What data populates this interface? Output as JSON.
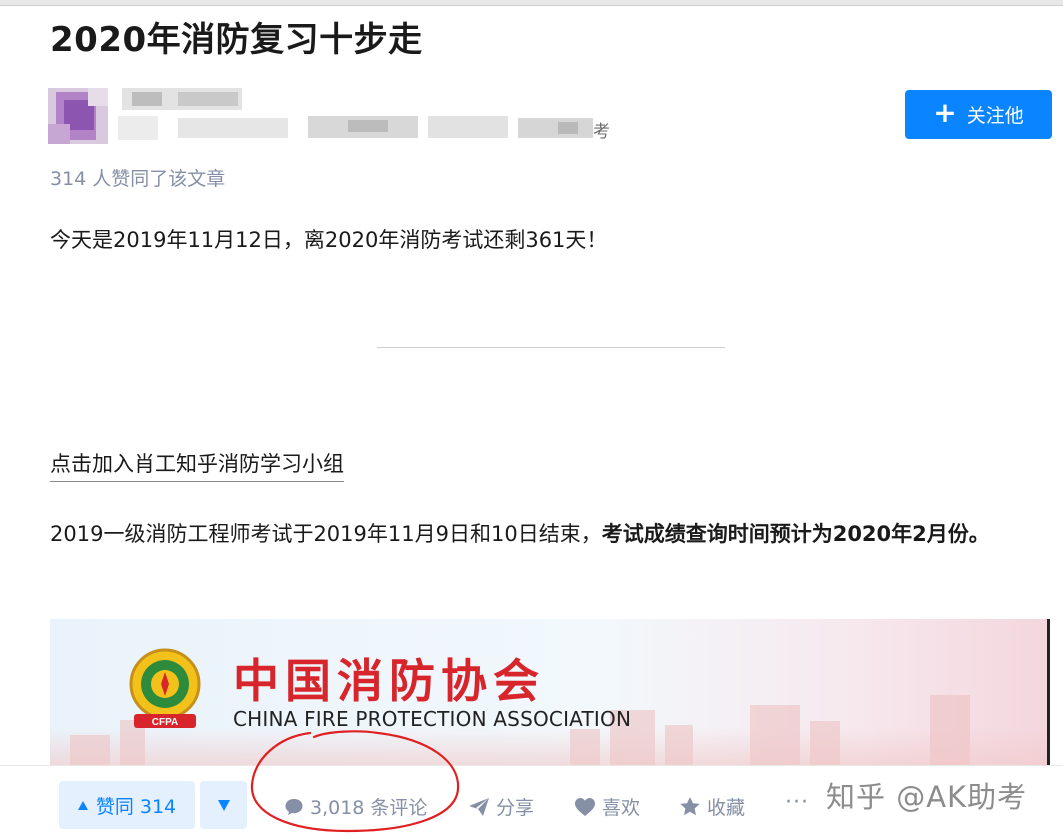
{
  "article": {
    "title": "2020年消防复习十步走",
    "author_tail": "考",
    "follow_label": "关注他",
    "upvote_summary": "314 人赞同了该文章",
    "para1": "今天是2019年11月12日，离2020年消防考试还剩361天！",
    "group_link": "点击加入肖工知乎消防学习小组",
    "para2_normal": "2019一级消防工程师考试于2019年11月9日和10日结束，",
    "para2_bold": "考试成绩查询时间预计为2020年2月份。"
  },
  "banner": {
    "cn_title": "中国消防协会",
    "en_title": "CHINA FIRE PROTECTION ASSOCIATION",
    "emblem_text": "CFPA"
  },
  "actions": {
    "upvote_label": "赞同 314",
    "comments_label": "3,018 条评论",
    "share_label": "分享",
    "like_label": "喜欢",
    "collect_label": "收藏",
    "more_label": "···"
  },
  "watermark": "知乎 @AK助考",
  "colors": {
    "accent": "#0a84ff",
    "muted": "#8590a6",
    "banner_red": "#d7252b",
    "annotation_red": "#e02020"
  },
  "icons": [
    "plus-icon",
    "triangle-up-icon",
    "triangle-down-icon",
    "comment-icon",
    "share-icon",
    "heart-icon",
    "star-icon",
    "more-icon"
  ]
}
